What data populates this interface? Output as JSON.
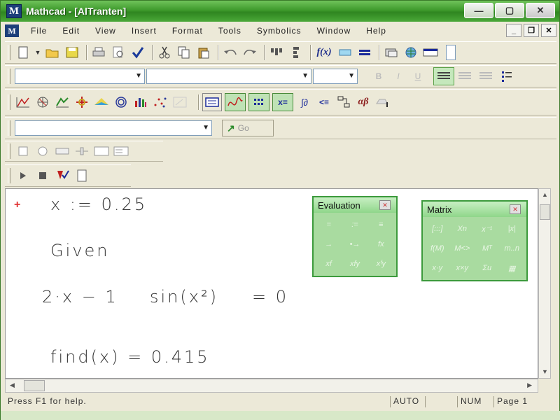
{
  "window": {
    "title": "Mathcad - [AlTranten]",
    "logo": "M",
    "minimize": "—",
    "maximize": "▢",
    "close": "✕"
  },
  "menubar": {
    "items": [
      "File",
      "Edit",
      "View",
      "Insert",
      "Format",
      "Tools",
      "Symbolics",
      "Window",
      "Help"
    ],
    "mdi": {
      "minimize": "_",
      "restore": "❐",
      "close": "✕"
    }
  },
  "toolbars": {
    "standard": {
      "function_label": "f(x)"
    },
    "formatting": {
      "style_value": "",
      "font_value": "",
      "size_value": "",
      "bold": "B",
      "italic": "I",
      "underline": "U"
    },
    "math": {
      "symbols": [
        "x=",
        "∫∂",
        "<≡",
        "αβ"
      ]
    },
    "resources": {
      "combo_value": "",
      "go_label": "Go"
    },
    "controls": {}
  },
  "worksheet": {
    "line1": "x := 0.25",
    "line2": "Given",
    "line3_left": "2·x − 1",
    "line3_mid": "sin(x²)",
    "line3_right": "= 0",
    "line4": "find(x) = 0.415"
  },
  "palettes": {
    "evaluation": {
      "title": "Evaluation",
      "cells": [
        "=",
        ":=",
        "≡",
        "→",
        "•→",
        "fx",
        "xf",
        "xfy",
        "xᶠy"
      ]
    },
    "matrix": {
      "title": "Matrix",
      "cells": [
        "[:::]",
        "Xn",
        "x⁻¹",
        "|x|",
        "f(M)",
        "M<>",
        "Mᵀ",
        "m..n",
        "x·y",
        "x×y",
        "Σu",
        "▦"
      ]
    }
  },
  "statusbar": {
    "help": "Press F1 for help.",
    "mode": "AUTO",
    "num": "NUM",
    "page": "Page 1"
  },
  "colors": {
    "titlebar": "#3e9a2c",
    "palette_border": "#3c9a3c",
    "cursor": "#e03030"
  }
}
